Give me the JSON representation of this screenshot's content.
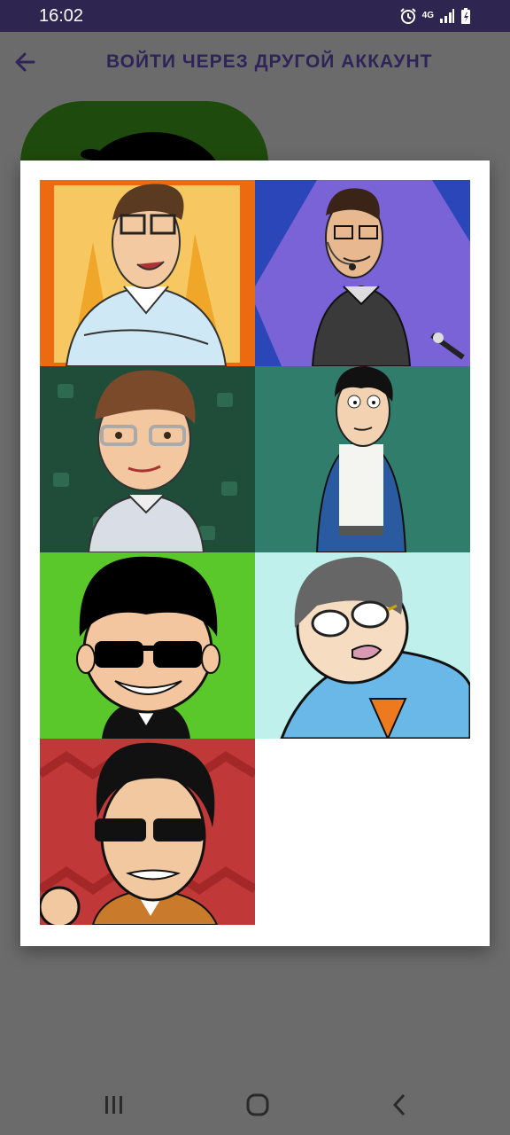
{
  "status_bar": {
    "time": "16:02",
    "network": "4G",
    "icons": [
      "alarm-icon",
      "network-4g-icon",
      "signal-icon",
      "battery-charging-icon"
    ]
  },
  "app_bar": {
    "title": "ВОЙТИ ЧЕРЕЗ ДРУГОЙ АККАУНТ",
    "back_icon": "arrow-left-icon"
  },
  "colors": {
    "status_bar": "#2e2550",
    "title": "#2e245a",
    "scrim": "#6b6b6b",
    "dialog": "#ffffff"
  },
  "avatars": [
    {
      "id": 1,
      "background": "#f0a030"
    },
    {
      "id": 2,
      "background": "#7a63d6"
    },
    {
      "id": 3,
      "background": "#1f4d3a"
    },
    {
      "id": 4,
      "background": "#2f7d6a"
    },
    {
      "id": 5,
      "background": "#5ac82a"
    },
    {
      "id": 6,
      "background": "#bff0ec"
    },
    {
      "id": 7,
      "background": "#c03838"
    }
  ],
  "nav_bar": {
    "icons": [
      "recent-apps-icon",
      "home-icon",
      "back-icon"
    ]
  }
}
